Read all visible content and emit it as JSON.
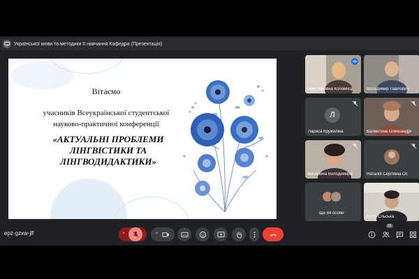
{
  "presentation_bar": {
    "title": "Української мови та методики її навчання Кафедра (Презентація)",
    "icon": "presentation-icon"
  },
  "slide": {
    "greeting": "Вітаємо",
    "line1": "учасників Всеукраїнської студентської",
    "line2": "науково-практичної конференції",
    "title_l1": "«АКТУАЛЬНІ ПРОБЛЕМИ",
    "title_l2": "ЛІНГВІСТИКИ ТА",
    "title_l3": "ЛІНГВОДИДАКТИКИ»"
  },
  "participants": [
    {
      "name": "Інна Іванівна Коломієць",
      "state": "speaking"
    },
    {
      "name": "Володимир Павлович",
      "state": "video"
    },
    {
      "name": "Лариса Кружиліна",
      "initial": "Л",
      "state": "muted"
    },
    {
      "name": "Валентина Олександрівна",
      "state": "muted"
    },
    {
      "name": "Василина Володимирівна",
      "state": "muted"
    },
    {
      "name": "Наталія Сергіївна Ос",
      "state": "muted"
    },
    {
      "name": "Ще 84 особи",
      "state": "more"
    },
    {
      "name": "Алла Сльська",
      "state": "video"
    }
  ],
  "meeting": {
    "code": "epz-gzxw-jlf",
    "participants_count": "92"
  },
  "colors": {
    "accent": "#8ab4f8",
    "hangup": "#ea4335",
    "muted_mic": "#8c1d18",
    "tile_bg": "#3c4043"
  }
}
